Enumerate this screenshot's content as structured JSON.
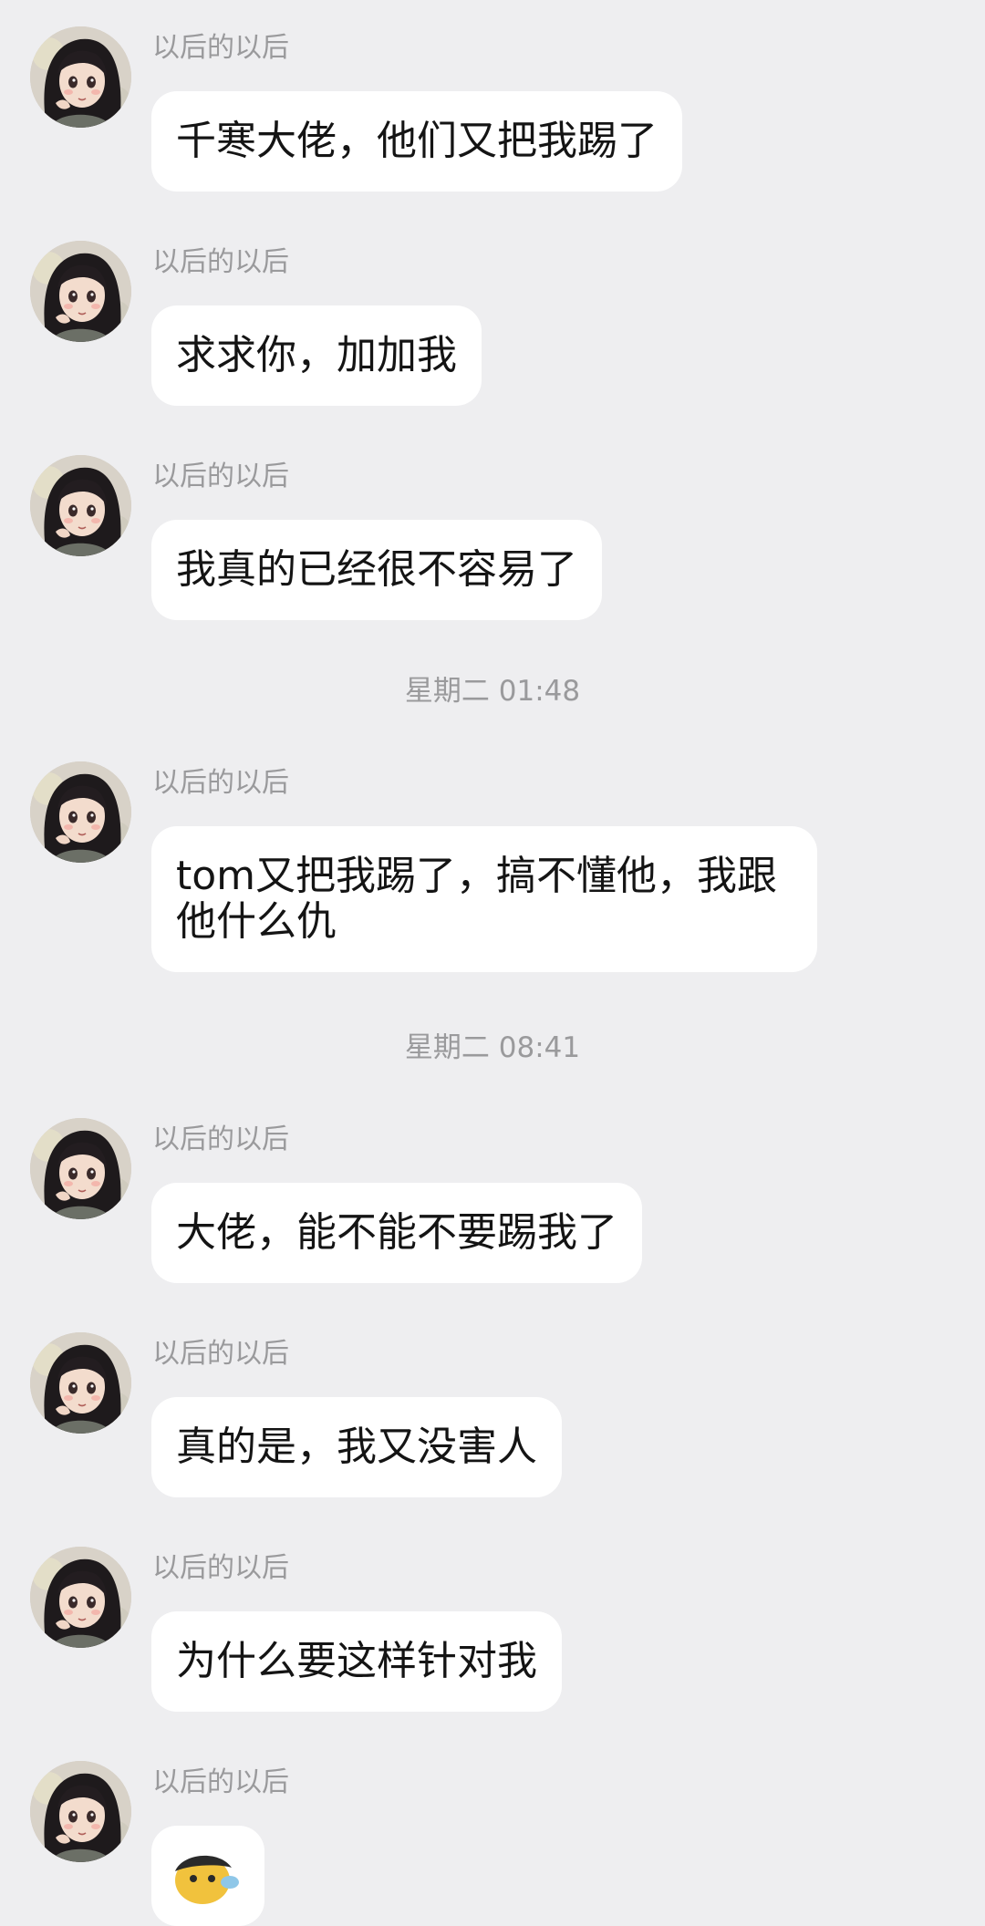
{
  "sender_name": "以后的以后",
  "messages": [
    {
      "text": "千寒大佬，他们又把我踢了"
    },
    {
      "text": "求求你，加加我"
    },
    {
      "text": "我真的已经很不容易了"
    },
    {
      "text": "tom又把我踢了，搞不懂他，我跟他什么仇"
    },
    {
      "text": "大佬，能不能不要踢我了"
    },
    {
      "text": "真的是，我又没害人"
    },
    {
      "text": "为什么要这样针对我"
    },
    {
      "text": "",
      "type": "sticker",
      "icon": "cartoon-sticker"
    }
  ],
  "timestamps": [
    "星期二 01:48",
    "星期二 08:41"
  ],
  "colors": {
    "background": "#EEEEF0",
    "bubble": "#FFFFFF",
    "meta_text": "#9A9A9C",
    "message_text": "#141414"
  }
}
